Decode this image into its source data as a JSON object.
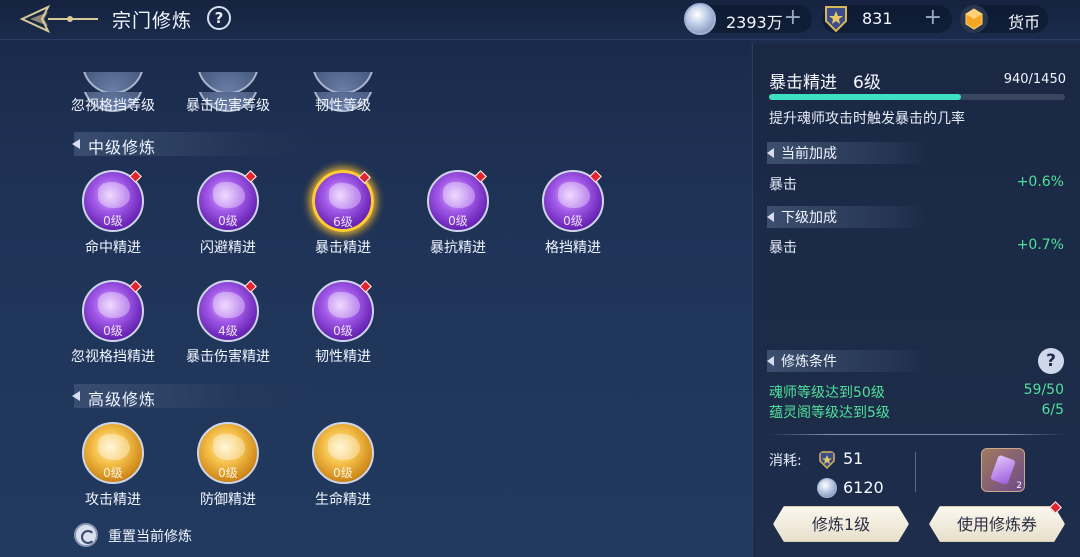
{
  "header": {
    "title": "宗门修炼",
    "help_icon": "?",
    "resources": [
      {
        "icon": "silver-coin-icon",
        "value": "2393万",
        "plus": "+"
      },
      {
        "icon": "medal-badge-icon",
        "value": "831",
        "plus": "+"
      },
      {
        "icon": "gold-gem-icon",
        "value": "货币"
      }
    ]
  },
  "left": {
    "top_partial_row": [
      {
        "label": "忽视格挡等级"
      },
      {
        "label": "暴击伤害等级"
      },
      {
        "label": "韧性等级"
      }
    ],
    "intermediate": {
      "header": "中级修炼",
      "row1": [
        {
          "label": "命中精进",
          "level": "0级"
        },
        {
          "label": "闪避精进",
          "level": "0级"
        },
        {
          "label": "暴击精进",
          "level": "6级"
        },
        {
          "label": "暴抗精进",
          "level": "0级"
        },
        {
          "label": "格挡精进",
          "level": "0级"
        }
      ],
      "row2": [
        {
          "label": "忽视格挡精进",
          "level": "0级"
        },
        {
          "label": "暴击伤害精进",
          "level": "4级"
        },
        {
          "label": "韧性精进",
          "level": "0级"
        }
      ]
    },
    "advanced": {
      "header": "高级修炼",
      "row": [
        {
          "label": "攻击精进",
          "level": "0级"
        },
        {
          "label": "防御精进",
          "level": "0级"
        },
        {
          "label": "生命精进",
          "level": "0级"
        }
      ]
    },
    "reset_label": "重置当前修炼"
  },
  "panel": {
    "title": "暴击精进",
    "level": "6级",
    "exp": "940/1450",
    "exp_progress": 0.648,
    "description": "提升魂师攻击时触发暴击的几率",
    "current_bonus": {
      "header": "当前加成",
      "stat": "暴击",
      "value": "+0.6%"
    },
    "next_bonus": {
      "header": "下级加成",
      "stat": "暴击",
      "value": "+0.7%"
    },
    "conditions": {
      "header": "修炼条件",
      "help": "?",
      "items": [
        {
          "text": "魂师等级达到50级",
          "progress": "59/50"
        },
        {
          "text": "蕴灵阁等级达到5级",
          "progress": "6/5"
        }
      ]
    },
    "cost": {
      "label": "消耗:",
      "medal": "51",
      "silver": "6120",
      "ticket_count": "2"
    },
    "buttons": {
      "train": "修炼1级",
      "use_ticket": "使用修炼券"
    },
    "colors": {
      "accent_green": "#4fe09a",
      "progress": "#3ee0c4",
      "selected_ring": "#ffcc33"
    }
  }
}
